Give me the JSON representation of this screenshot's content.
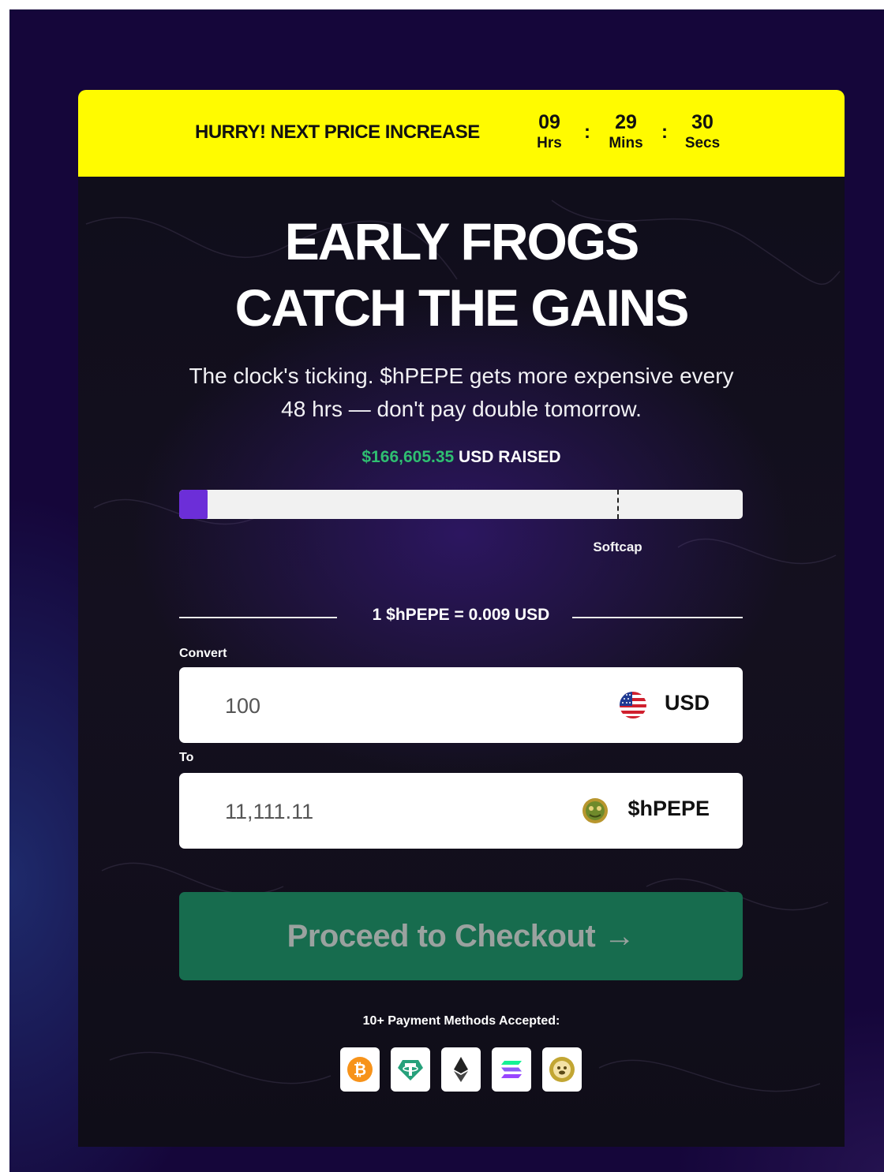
{
  "banner": {
    "title": "HURRY! NEXT PRICE INCREASE",
    "countdown": {
      "hours": "09",
      "hours_label": "Hrs",
      "minutes": "29",
      "minutes_label": "Mins",
      "seconds": "30",
      "seconds_label": "Secs",
      "separator": ":"
    }
  },
  "hero": {
    "headline_line1": "EARLY FROGS",
    "headline_line2": "CATCH THE GAINS",
    "subtitle": "The clock's ticking. $hPEPE gets more expensive every 48 hrs — don't pay double tomorrow."
  },
  "raise": {
    "amount": "$166,605.35",
    "suffix": " USD RAISED",
    "progress_fraction": 0.05,
    "softcap_fraction": 0.778,
    "softcap_label": "Softcap"
  },
  "rate": "1 $hPEPE = 0.009 USD",
  "convert": {
    "label": "Convert",
    "value": "100",
    "currency": "USD",
    "currency_icon": "us-flag-icon"
  },
  "to": {
    "label": "To",
    "value": "11,111.11",
    "currency": "$hPEPE",
    "currency_icon": "hpepe-coin-icon"
  },
  "checkout_label": "Proceed to Checkout →",
  "payment": {
    "title": "10+ Payment Methods Accepted:",
    "methods": [
      "bitcoin-icon",
      "tether-icon",
      "ethereum-icon",
      "solana-icon",
      "dogecoin-icon"
    ]
  },
  "colors": {
    "banner": "#fffb00",
    "raised_amount": "#2fbf71",
    "progress_fill": "#6c2ed8",
    "checkout_bg": "#176c4e",
    "page_bg": "#15063a"
  }
}
